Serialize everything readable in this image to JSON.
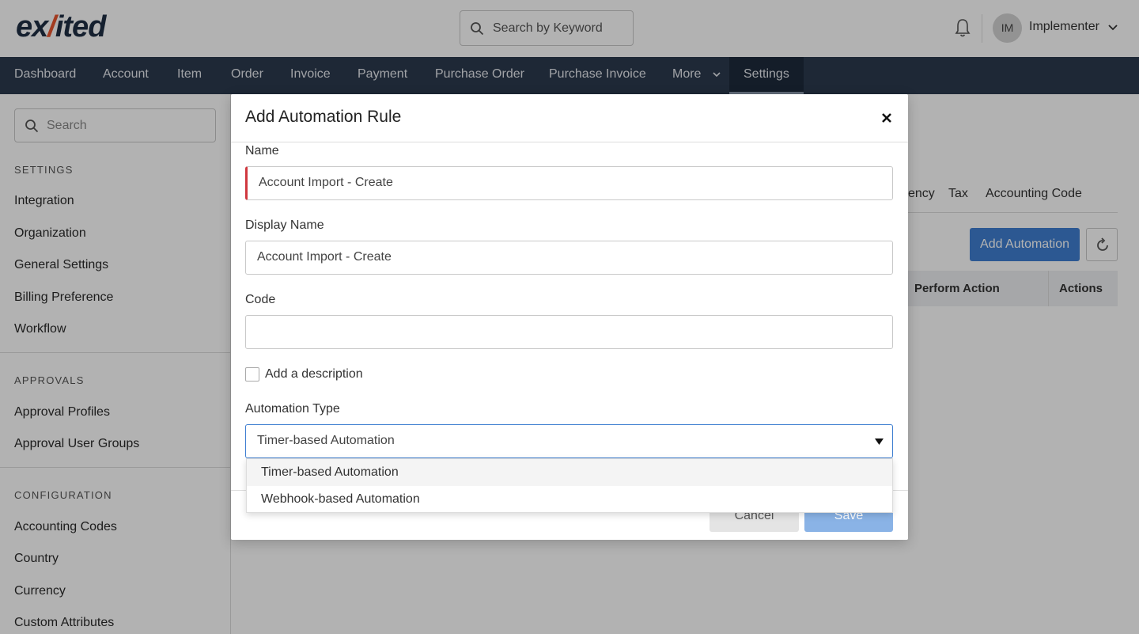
{
  "brand": {
    "logo_pre": "ex",
    "logo_accent": "/",
    "logo_post": "ited"
  },
  "header": {
    "search_placeholder": "Search by Keyword",
    "avatar_initials": "IM",
    "user_name": "Implementer"
  },
  "nav": {
    "items": [
      "Dashboard",
      "Account",
      "Item",
      "Order",
      "Invoice",
      "Payment",
      "Purchase Order",
      "Purchase Invoice",
      "More",
      "Settings"
    ],
    "active": "Settings"
  },
  "sidebar": {
    "search_placeholder": "Search",
    "sections": [
      {
        "heading": "SETTINGS",
        "items": [
          "Integration",
          "Organization",
          "General Settings",
          "Billing Preference",
          "Workflow"
        ]
      },
      {
        "heading": "APPROVALS",
        "items": [
          "Approval Profiles",
          "Approval User Groups"
        ]
      },
      {
        "heading": "CONFIGURATION",
        "items": [
          "Accounting Codes",
          "Country",
          "Currency",
          "Custom Attributes"
        ]
      }
    ]
  },
  "main": {
    "tabs": [
      "ency",
      "Tax",
      "Accounting Code"
    ],
    "add_button": "Add Automation",
    "table_headers": [
      "Perform Action",
      "Actions"
    ]
  },
  "modal": {
    "title": "Add Automation Rule",
    "name_label": "Name",
    "name_value": "Account Import - Create",
    "display_name_label": "Display Name",
    "display_name_value": "Account Import - Create",
    "code_label": "Code",
    "code_value": "",
    "description_checkbox_label": "Add a description",
    "description_checked": false,
    "automation_type_label": "Automation Type",
    "automation_type_value": "Timer-based Automation",
    "automation_type_options": [
      "Timer-based Automation",
      "Webhook-based Automation"
    ],
    "cancel_label": "Cancel",
    "save_label": "Save"
  },
  "colors": {
    "nav_bg": "#2c3a4e",
    "primary": "#3f7fd1",
    "error": "#d0383f",
    "logo_accent": "#e8552f"
  }
}
